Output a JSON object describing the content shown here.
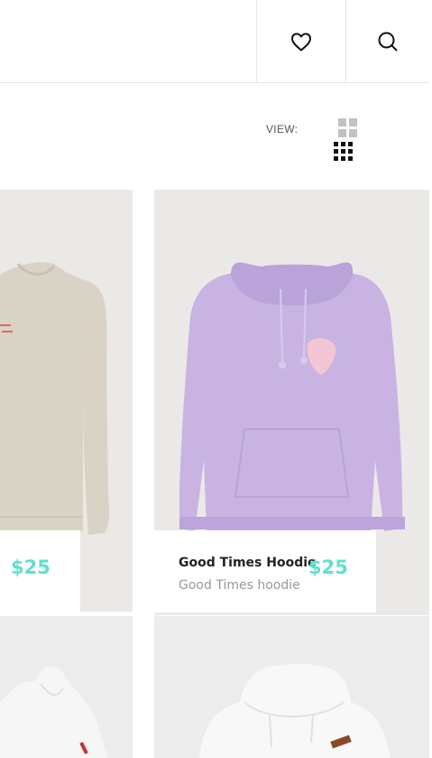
{
  "header": {
    "wishlist_icon": "heart-icon",
    "search_icon": "search-icon"
  },
  "view_toggle": {
    "label": "VIEW:",
    "options": [
      "grid-2-icon",
      "grid-3-icon"
    ]
  },
  "products": [
    {
      "name": "",
      "subtitle": "",
      "price": "$25",
      "image": "beige-sweatshirt",
      "colors": {
        "garment": "#d8d3c6",
        "print": "#e8655a"
      }
    },
    {
      "name": "Good Times Hoodie",
      "subtitle": "Good Times hoodie",
      "price": "$25",
      "image": "lilac-hoodie",
      "colors": {
        "garment": "#c8b3e3",
        "print": "#f2c6d4"
      }
    },
    {
      "name": "",
      "subtitle": "",
      "price": "",
      "image": "white-hoodie",
      "colors": {
        "garment": "#f6f6f6"
      }
    },
    {
      "name": "",
      "subtitle": "",
      "price": "",
      "image": "white-hoodie",
      "colors": {
        "garment": "#f8f8f8"
      }
    }
  ],
  "accent_color": "#5ee0cf"
}
